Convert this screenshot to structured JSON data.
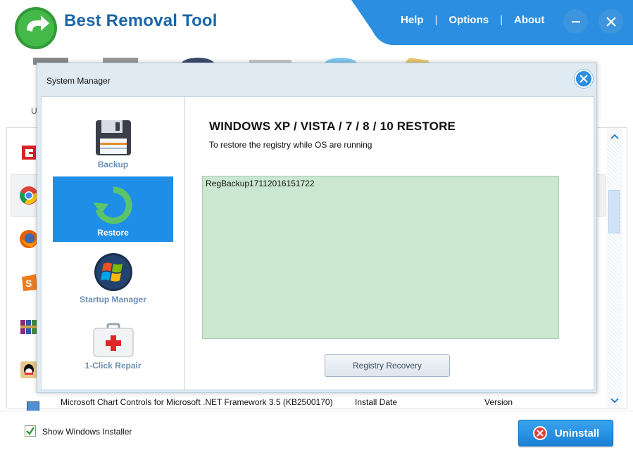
{
  "app": {
    "title": "Best Removal Tool",
    "menu": {
      "help": "Help",
      "options": "Options",
      "about": "About",
      "separator": "|"
    },
    "toolbar_partial_label": "U"
  },
  "dialog": {
    "title": "System Manager",
    "sidebar": [
      {
        "label": "Backup",
        "icon": "floppy-disk-icon",
        "active": false
      },
      {
        "label": "Restore",
        "icon": "restore-arrow-icon",
        "active": true
      },
      {
        "label": "Startup Manager",
        "icon": "windows-logo-icon",
        "active": false
      },
      {
        "label": "1-Click Repair",
        "icon": "first-aid-kit-icon",
        "active": false
      }
    ],
    "heading": "WINDOWS XP / VISTA / 7 / 8 / 10 RESTORE",
    "subheading": "To restore the registry while OS are running",
    "backups": [
      "RegBackup17112016151722"
    ],
    "recovery_button": "Registry Recovery"
  },
  "list": {
    "icons": [
      "red-app-icon",
      "chrome-icon",
      "firefox-icon",
      "sogou-icon",
      "winrar-icon",
      "qq-icon"
    ],
    "partial_row": {
      "name": "Microsoft Chart Controls for Microsoft .NET Framework 3.5 (KB2500170)",
      "install_date_label": "Install Date",
      "version_label": "Version"
    }
  },
  "footer": {
    "show_installer_label": "Show Windows Installer",
    "show_installer_checked": true,
    "uninstall_label": "Uninstall"
  },
  "colors": {
    "brand_blue": "#1a66a8",
    "header_blue": "#2b8ee0",
    "active_blue": "#1f8ee6",
    "backup_box_green": "#cbe7d0"
  }
}
